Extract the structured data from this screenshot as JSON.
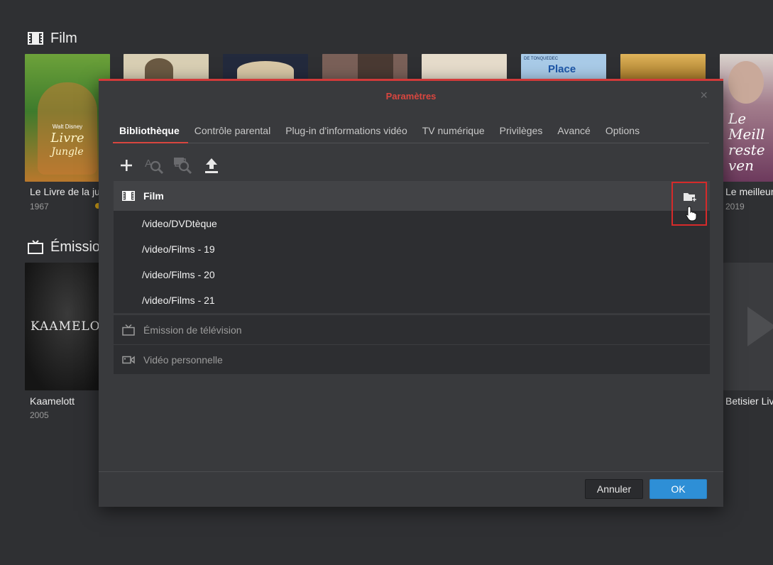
{
  "background": {
    "section_film": {
      "title": "Film",
      "icon": "film-icon"
    },
    "section_tv": {
      "title": "Émission",
      "icon": "tv-icon"
    },
    "posters_row1": [
      {
        "title": "Le Livre de la ju",
        "year": "1967",
        "color": "#3e7b2c"
      },
      {
        "title": "",
        "year": "",
        "color": "#d9cfb4"
      },
      {
        "title": "",
        "year": "",
        "color": "#232a3d"
      },
      {
        "title": "",
        "year": "",
        "color": "#7a6058"
      },
      {
        "title": "",
        "year": "",
        "color": "#e6dccb"
      },
      {
        "title": "",
        "year": "",
        "color": "#8fb6d8"
      },
      {
        "title": "",
        "year": "",
        "color": "#a67a2a"
      },
      {
        "title": "Le meilleur",
        "year": "2019",
        "color": "#6d3a5d"
      }
    ],
    "posters_row2": [
      {
        "title": "Kaamelott",
        "year": "2005"
      },
      {
        "title": "Betisier Liv",
        "year": ""
      }
    ],
    "poster_art": {
      "jungle": {
        "brand": "Walt Disney",
        "title_line1": "Livre",
        "title_line2": "Jungle"
      },
      "place": {
        "text": "Place",
        "small": "DE TONQUEDEC"
      },
      "meilleur": {
        "text": "Le Meill reste ven"
      },
      "kaamelott": {
        "text": "KAAMELOTT"
      }
    }
  },
  "dialog": {
    "title": "Paramètres",
    "close_label": "×",
    "tabs": [
      {
        "label": "Bibliothèque",
        "active": true
      },
      {
        "label": "Contrôle parental",
        "active": false
      },
      {
        "label": "Plug-in d'informations vidéo",
        "active": false
      },
      {
        "label": "TV numérique",
        "active": false
      },
      {
        "label": "Privilèges",
        "active": false
      },
      {
        "label": "Avancé",
        "active": false
      },
      {
        "label": "Options",
        "active": false
      }
    ],
    "toolbar": [
      {
        "name": "add-library-button",
        "icon": "plus-icon"
      },
      {
        "name": "rescan-button",
        "icon": "text-search-icon"
      },
      {
        "name": "scan-media-button",
        "icon": "image-search-icon"
      },
      {
        "name": "export-button",
        "icon": "upload-icon"
      }
    ],
    "libraries": [
      {
        "name": "Film",
        "icon": "film-icon",
        "expanded": true,
        "paths": [
          "/video/DVDtèque",
          "/video/Films - 19",
          "/video/Films - 20",
          "/video/Films - 21"
        ]
      },
      {
        "name": "Émission de télévision",
        "icon": "tv-icon",
        "expanded": false
      },
      {
        "name": "Vidéo personnelle",
        "icon": "camera-icon",
        "expanded": false
      }
    ],
    "add_folder_icon": "folder-plus-icon",
    "footer": {
      "cancel_label": "Annuler",
      "ok_label": "OK"
    },
    "colors": {
      "accent": "#d9463f",
      "ok_blue": "#2e8fd6",
      "highlight": "#d62a2a"
    }
  }
}
